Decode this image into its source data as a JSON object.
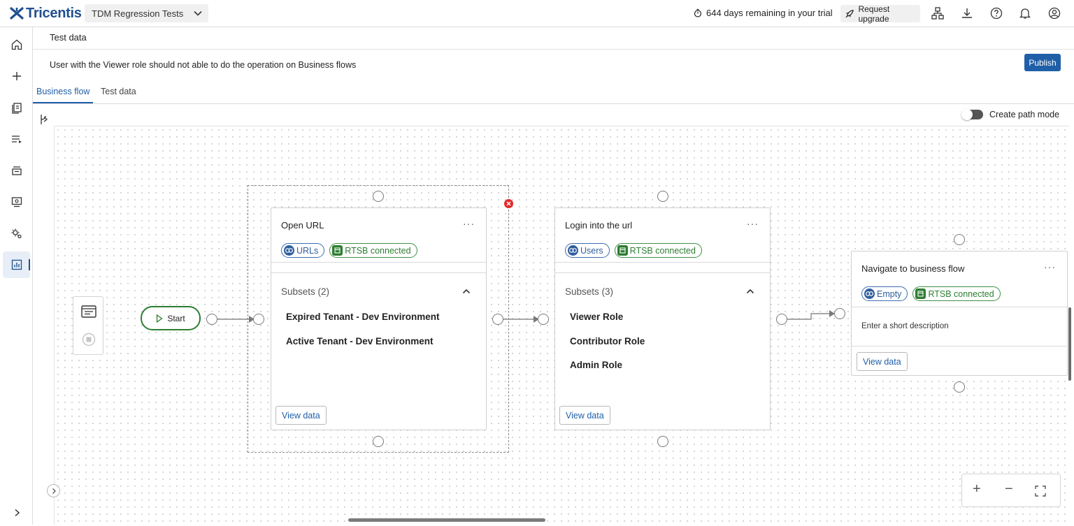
{
  "header": {
    "brand": "Tricentis",
    "project": "TDM Regression Tests",
    "trial_text": "644 days remaining in your trial",
    "upgrade_label": "Request upgrade"
  },
  "page": {
    "breadcrumb": "Test data",
    "description": "User with the Viewer role should not able to do the operation on Business flows",
    "publish_label": "Publish",
    "tabs": [
      {
        "label": "Business flow",
        "active": true
      },
      {
        "label": "Test data",
        "active": false
      }
    ],
    "create_path_mode_label": "Create path mode",
    "create_path_mode_on": false
  },
  "flow": {
    "start_label": "Start",
    "nodes": [
      {
        "title": "Open URL",
        "menu": "···",
        "chips": [
          {
            "label": "URLs",
            "kind": "link"
          },
          {
            "label": "RTSB connected",
            "kind": "db"
          }
        ],
        "subsets_label": "Subsets (2)",
        "subsets": [
          "Expired Tenant - Dev Environment",
          "Active Tenant - Dev Environment"
        ],
        "view_label": "View data"
      },
      {
        "title": "Login into the url",
        "menu": "···",
        "chips": [
          {
            "label": "Users",
            "kind": "link"
          },
          {
            "label": "RTSB connected",
            "kind": "db"
          }
        ],
        "subsets_label": "Subsets (3)",
        "subsets": [
          "Viewer Role",
          "Contributor Role",
          "Admin Role"
        ],
        "view_label": "View data"
      },
      {
        "title": "Navigate to business flow",
        "menu": "···",
        "chips": [
          {
            "label": "Empty",
            "kind": "link"
          },
          {
            "label": "RTSB connected",
            "kind": "db"
          }
        ],
        "description": "Enter a short description",
        "view_label": "View data"
      }
    ]
  },
  "zoom_controls": {
    "plus": "+",
    "minus": "−"
  },
  "colors": {
    "accent": "#1f5fa8",
    "success": "#2e7d32",
    "error": "#e32a2a"
  }
}
